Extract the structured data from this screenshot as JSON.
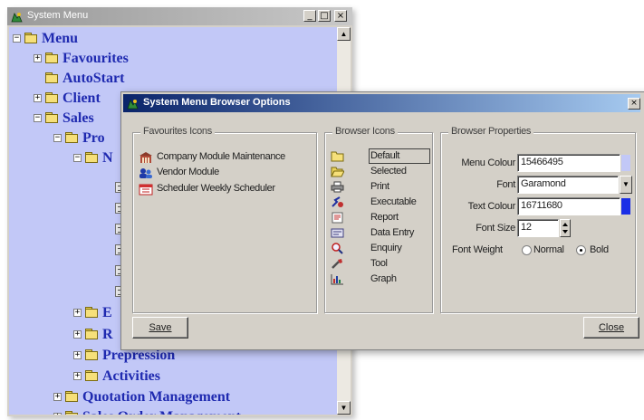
{
  "tree_window": {
    "title": "System Menu",
    "controls": {
      "minimize": "_",
      "maximize": "□",
      "close": "×"
    },
    "items": [
      {
        "label": "Menu",
        "expander": "−"
      },
      {
        "label": "Favourites",
        "expander": "+"
      },
      {
        "label": "AutoStart",
        "expander": ""
      },
      {
        "label": "Client",
        "expander": "+"
      },
      {
        "label": "Sales",
        "expander": "−"
      },
      {
        "label": "Pro",
        "expander": "−"
      },
      {
        "label": "N",
        "expander": "−"
      },
      {
        "label": "E",
        "expander": "+"
      },
      {
        "label": "R",
        "expander": "+"
      },
      {
        "label": "Prepression",
        "expander": "+"
      },
      {
        "label": "Activities",
        "expander": "+"
      },
      {
        "label": "Quotation Management",
        "expander": "+"
      },
      {
        "label": "Sales Order Management",
        "expander": "+"
      }
    ]
  },
  "dialog": {
    "title": "System Menu Browser Options",
    "close_glyph": "×",
    "favourites": {
      "title": "Favourites Icons",
      "items": [
        {
          "label": "Company Module Maintenance",
          "icon": "building-icon"
        },
        {
          "label": "Vendor Module",
          "icon": "users-icon"
        },
        {
          "label": "Scheduler Weekly Scheduler",
          "icon": "calendar-icon"
        }
      ]
    },
    "browser_icons": {
      "title": "Browser Icons",
      "items": [
        {
          "label": "Default",
          "icon": "folder-closed-icon",
          "selected": true
        },
        {
          "label": "Selected",
          "icon": "folder-open-icon"
        },
        {
          "label": "Print",
          "icon": "printer-icon"
        },
        {
          "label": "Executable",
          "icon": "executable-icon"
        },
        {
          "label": "Report",
          "icon": "report-icon"
        },
        {
          "label": "Data Entry",
          "icon": "data-entry-icon"
        },
        {
          "label": "Enquiry",
          "icon": "enquiry-icon"
        },
        {
          "label": "Tool",
          "icon": "tool-icon"
        },
        {
          "label": "Graph",
          "icon": "graph-icon"
        }
      ]
    },
    "properties": {
      "title": "Browser Properties",
      "menu_colour_label": "Menu Colour",
      "menu_colour_value": "15466495",
      "menu_colour_swatch": "#c2c8f7",
      "font_label": "Font",
      "font_value": "Garamond",
      "text_colour_label": "Text Colour",
      "text_colour_value": "16711680",
      "text_colour_swatch": "#1a2ee6",
      "font_size_label": "Font Size",
      "font_size_value": "12",
      "font_weight_label": "Font Weight",
      "font_weight_normal": "Normal",
      "font_weight_bold": "Bold",
      "font_weight_selected": "Bold"
    },
    "save_label": "Save",
    "close_label": "Close"
  }
}
